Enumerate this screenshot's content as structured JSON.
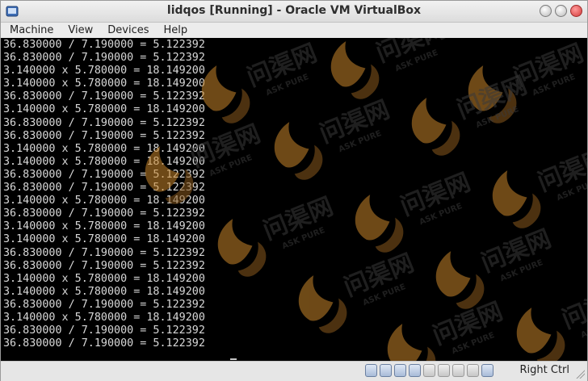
{
  "window": {
    "title": "lidqos [Running] - Oracle VM VirtualBox"
  },
  "menu": {
    "items": [
      "Machine",
      "View",
      "Devices",
      "Help"
    ]
  },
  "console": {
    "lines": [
      "36.830000 / 7.190000 = 5.122392",
      "36.830000 / 7.190000 = 5.122392",
      "3.140000 x 5.780000 = 18.149200",
      "3.140000 x 5.780000 = 18.149200",
      "36.830000 / 7.190000 = 5.122392",
      "3.140000 x 5.780000 = 18.149200",
      "36.830000 / 7.190000 = 5.122392",
      "36.830000 / 7.190000 = 5.122392",
      "3.140000 x 5.780000 = 18.149200",
      "3.140000 x 5.780000 = 18.149200",
      "36.830000 / 7.190000 = 5.122392",
      "36.830000 / 7.190000 = 5.122392",
      "3.140000 x 5.780000 = 18.149200",
      "36.830000 / 7.190000 = 5.122392",
      "3.140000 x 5.780000 = 18.149200",
      "3.140000 x 5.780000 = 18.149200",
      "36.830000 / 7.190000 = 5.122392",
      "36.830000 / 7.190000 = 5.122392",
      "3.140000 x 5.780000 = 18.149200",
      "3.140000 x 5.780000 = 18.149200",
      "36.830000 / 7.190000 = 5.122392",
      "3.140000 x 5.780000 = 18.149200",
      "36.830000 / 7.190000 = 5.122392",
      "36.830000 / 7.190000 = 5.122392"
    ]
  },
  "watermark": {
    "text_cn": "问渠网",
    "text_en": "ASK PURE"
  },
  "statusbar": {
    "icons": [
      "hard-disk-icon",
      "optical-drive-icon",
      "usb-icon",
      "network-icon",
      "shared-folder-icon",
      "display-icon",
      "video-capture-icon",
      "mouse-integration-icon",
      "host-key-arrow-icon"
    ],
    "host_key": "Right Ctrl"
  },
  "colors": {
    "console_text": "#d8d8d8",
    "screen_bg": "#000000",
    "watermark_flame": "#c8862a"
  }
}
